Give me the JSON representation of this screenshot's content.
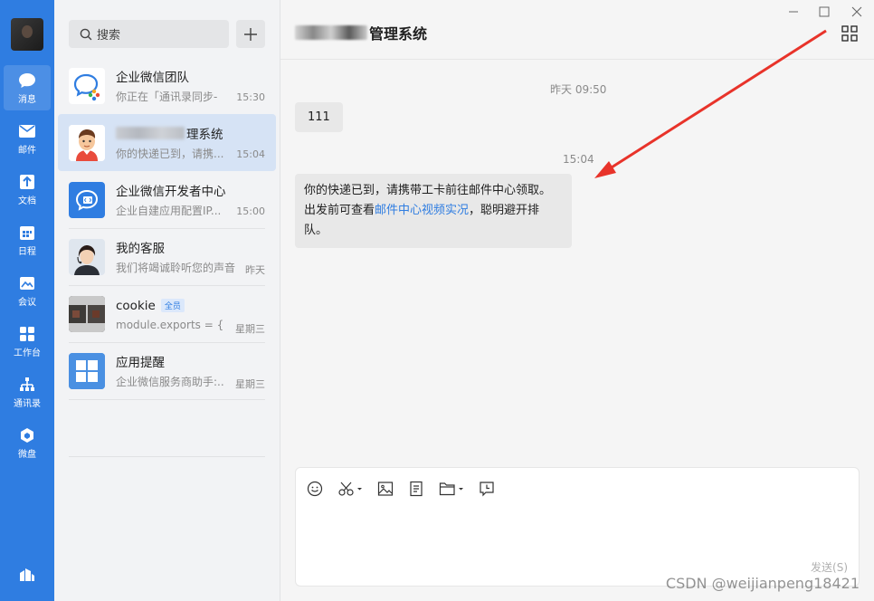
{
  "rail": {
    "items": [
      {
        "label": "消息",
        "icon": "chat-bubble-icon"
      },
      {
        "label": "邮件",
        "icon": "mail-icon"
      },
      {
        "label": "文档",
        "icon": "document-icon"
      },
      {
        "label": "日程",
        "icon": "calendar-icon"
      },
      {
        "label": "会议",
        "icon": "meeting-icon"
      },
      {
        "label": "工作台",
        "icon": "workbench-icon"
      },
      {
        "label": "通讯录",
        "icon": "contacts-icon"
      },
      {
        "label": "微盘",
        "icon": "drive-icon"
      }
    ]
  },
  "search": {
    "placeholder": "搜索"
  },
  "conversations": [
    {
      "name": "企业微信团队",
      "preview": "你正在「通讯录同步-",
      "time": "15:30"
    },
    {
      "name": "理系统",
      "preview": "你的快递已到，请携...",
      "time": "15:04"
    },
    {
      "name": "企业微信开发者中心",
      "preview": "企业自建应用配置IP...",
      "time": "15:00"
    },
    {
      "name": "我的客服",
      "preview": "我们将竭诚聆听您的声音",
      "time": "昨天"
    },
    {
      "name": "cookie",
      "badge": "全员",
      "preview": "module.exports = {",
      "time": "星期三"
    },
    {
      "name": "应用提醒",
      "preview": "企业微信服务商助手:...",
      "time": "星期三"
    }
  ],
  "chat": {
    "title": "管理系统",
    "messages": [
      {
        "timestamp": "昨天 09:50",
        "text": "111"
      },
      {
        "timestamp": "15:04",
        "line1": "你的快递已到，请携带工卡前往邮件中心领取。",
        "line2_pre": "出发前可查看",
        "line2_link": "邮件中心视频实况",
        "line2_post": "，聪明避开排队。"
      }
    ],
    "send_label": "发送(S)"
  },
  "watermark": "CSDN @weijianpeng18421",
  "colors": {
    "rail": "#2f7de1",
    "active_conv": "#d6e3f5",
    "arrow": "#e8332a",
    "link": "#2f7de1"
  }
}
